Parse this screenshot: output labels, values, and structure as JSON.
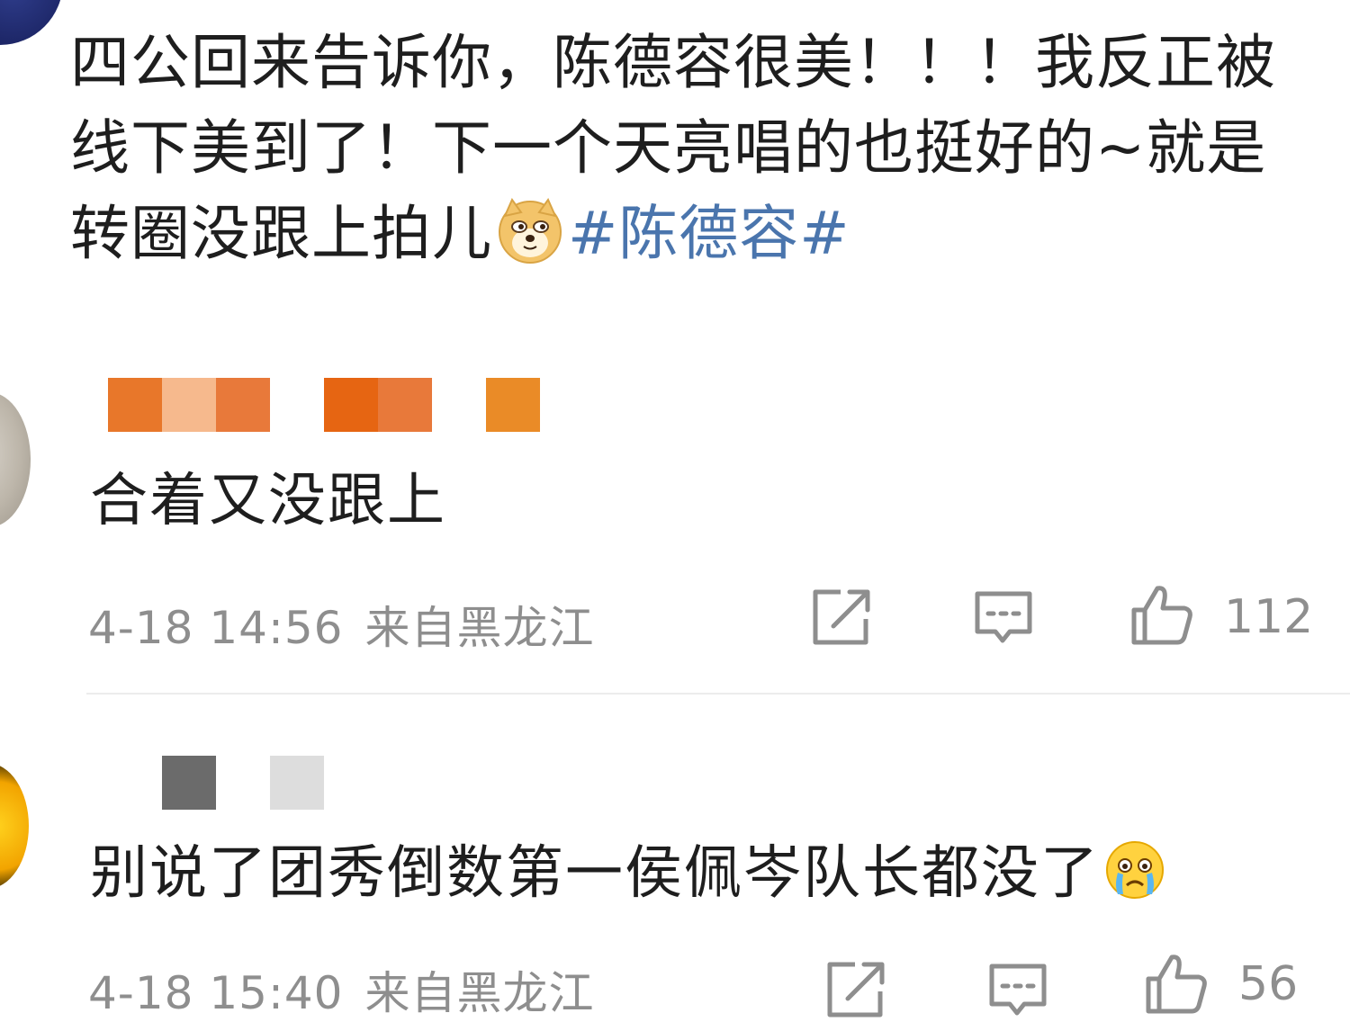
{
  "post": {
    "text_part1": "四公回来告诉你，陈德容很美！！！我反正被线下美到了！下一个天亮唱的也挺好的~就是转圈没跟上拍儿",
    "emoji": "doge-emoji",
    "topic": "#陈德容#"
  },
  "comments": [
    {
      "username_blocks": [
        "#e8772a",
        "#f6b98d",
        "#e8793a",
        "#ffffff",
        "#e66512",
        "#e8793a",
        "#ffffff",
        "#ea8b27"
      ],
      "text": "合着又没跟上",
      "time": "4-18 14:56",
      "location": "来自黑龙江",
      "likes": "112",
      "icons": [
        "share-icon",
        "comment-icon",
        "like-icon"
      ]
    },
    {
      "username_blocks": [
        "#6b6b6b",
        "#ffffff",
        "#dddddd"
      ],
      "text": "别说了团秀倒数第一侯佩岑队长都没了",
      "emoji": "crying-emoji",
      "time": "4-18 15:40",
      "location": "来自黑龙江",
      "likes": "56",
      "icons": [
        "share-icon",
        "comment-icon",
        "like-icon"
      ]
    }
  ]
}
